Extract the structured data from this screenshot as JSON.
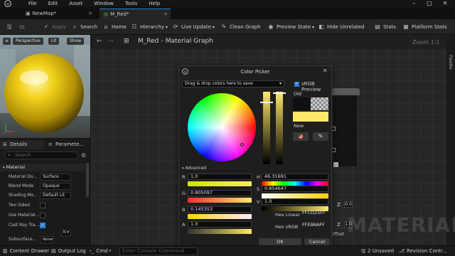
{
  "menubar": {
    "items": [
      "File",
      "Edit",
      "Asset",
      "Window",
      "Tools",
      "Help"
    ]
  },
  "tabs": [
    {
      "label": "NewMap*"
    },
    {
      "label": "M_Red*"
    }
  ],
  "toolbar": {
    "save_label": "",
    "apply_label": "Apply",
    "search_label": "Search",
    "home_label": "Home",
    "hierarchy_label": "Hierarchy",
    "live_update_label": "Live Update",
    "clean_graph_label": "Clean Graph",
    "preview_state_label": "Preview State",
    "hide_unrelated_label": "Hide Unrelated",
    "stats_label": "Stats",
    "platform_stats_label": "Platform Stats"
  },
  "viewport": {
    "perspective_label": "Perspective",
    "lit_label": "Lit",
    "show_label": "Show"
  },
  "details_panel": {
    "tab_details": "Details",
    "tab_parameters": "Paramete...",
    "search_placeholder": "Search",
    "section_label": "Material",
    "rows": [
      {
        "label": "Material Do...",
        "value": "Surface"
      },
      {
        "label": "Blend Mode",
        "value": "Opaque"
      },
      {
        "label": "Shading Mo...",
        "value": "Default Lit"
      },
      {
        "label": "Two Sided",
        "value": ""
      },
      {
        "label": "Use Material...",
        "value": ""
      },
      {
        "label": "Cast Ray Tra...",
        "value": ""
      },
      {
        "label": "Subsurface...",
        "value": "None"
      }
    ]
  },
  "graph": {
    "breadcrumb": "M_Red",
    "title": "Material Graph",
    "zoom": "Zoom 1:1",
    "palette_label": "Palette",
    "watermark": "MATERIAL",
    "node_values": [
      "Z",
      "0.0",
      "Z",
      "1.0",
      "Offset"
    ]
  },
  "color_picker": {
    "title": "Color Picker",
    "drop_hint": "Drag & drop colors here to save",
    "srgb_preview_label": "sRGB Preview",
    "old_label": "Old",
    "new_label": "New",
    "advanced_label": "Advanced",
    "r_label": "R",
    "r_value": "1.0",
    "g_label": "G",
    "g_value": "0.805097",
    "b_label": "B",
    "b_value": "0.145353",
    "a_label": "A",
    "a_value": "1.0",
    "h_label": "H",
    "h_value": "46.31691",
    "s_label": "S",
    "s_value": "0.854647",
    "v_label": "V",
    "v_value": "1.0",
    "hex_linear_label": "Hex Linear",
    "hex_linear_value": "FFCD25FF",
    "hex_srgb_label": "Hex sRGB",
    "hex_srgb_value": "FFE86AFF",
    "ok_label": "OK",
    "cancel_label": "Cancel",
    "colors": {
      "old": "#101010",
      "new": "#ffe86a"
    }
  },
  "statusbar": {
    "content_drawer": "Content Drawer",
    "output_log": "Output Log",
    "cmd": "Cmd",
    "console_placeholder": "Enter Console Command",
    "unsaved": "2 Unsaved",
    "revision_control": "Revision Contr..."
  }
}
